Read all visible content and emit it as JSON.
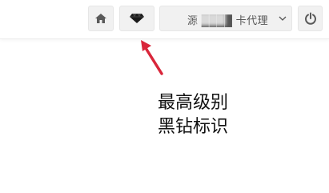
{
  "toolbar": {
    "home_icon": "home-icon",
    "diamond_icon": "black-diamond-icon",
    "user_name": "源 ████ 卡代理",
    "dropdown_icon": "chevron-down-icon",
    "power_icon": "power-icon"
  },
  "annotation": {
    "text_line1": "最高级别",
    "text_line2": "黑钻标识",
    "arrow_color": "#d9263a"
  },
  "colors": {
    "button_bg": "#f1f1f1",
    "icon_color": "#5a5a5a",
    "diamond_color": "#1a1a1a"
  }
}
